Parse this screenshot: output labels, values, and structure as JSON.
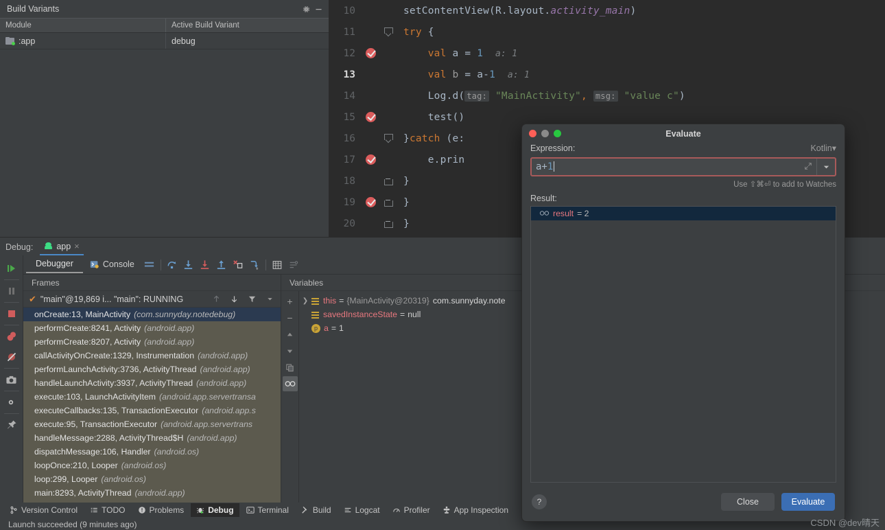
{
  "build_variants": {
    "title": "Build Variants",
    "gear_icon": "gear-icon",
    "minimize_icon": "minimize-icon",
    "columns": [
      "Module",
      "Active Build Variant"
    ],
    "rows": [
      {
        "module": ":app",
        "variant": "debug"
      }
    ]
  },
  "editor": {
    "lines": [
      {
        "num": "10",
        "tokens": [
          {
            "t": "setContentView(",
            "c": "k-plain"
          },
          {
            "t": "R",
            "c": "k-plain"
          },
          {
            "t": ".",
            "c": "k-plain"
          },
          {
            "t": "layout",
            "c": "k-plain"
          },
          {
            "t": ".",
            "c": "k-plain"
          },
          {
            "t": "activity_main",
            "c": "k-fld"
          },
          {
            "t": ")",
            "c": "k-plain"
          }
        ]
      },
      {
        "num": "11",
        "tokens": [
          {
            "t": "try",
            "c": "k-kw"
          },
          {
            "t": " {",
            "c": "k-plain"
          }
        ]
      },
      {
        "num": "12",
        "tokens": [
          {
            "t": "    val ",
            "c": "k-kw"
          },
          {
            "t": "a",
            "c": "k-plain"
          },
          {
            "t": " = ",
            "c": "k-plain"
          },
          {
            "t": "1",
            "c": "k-num"
          },
          {
            "t": "  ",
            "c": "k-plain"
          },
          {
            "t": "a: 1",
            "c": "k-hint"
          }
        ]
      },
      {
        "num": "13",
        "tokens": [
          {
            "t": "    val ",
            "c": "k-kw"
          },
          {
            "t": "b",
            "c": "k-dim"
          },
          {
            "t": " = ",
            "c": "k-plain"
          },
          {
            "t": "a-",
            "c": "k-plain"
          },
          {
            "t": "1",
            "c": "k-num"
          },
          {
            "t": "  ",
            "c": "k-plain"
          },
          {
            "t": "a: 1",
            "c": "k-hint"
          }
        ]
      },
      {
        "num": "14",
        "tokens": [
          {
            "t": "    Log.d(",
            "c": "k-plain"
          },
          {
            "t": "tag:",
            "c": "chip"
          },
          {
            "t": " ",
            "c": "k-plain"
          },
          {
            "t": "\"MainActivity\"",
            "c": "k-str"
          },
          {
            "t": ",",
            "c": "k-kw"
          },
          {
            "t": " ",
            "c": "k-plain"
          },
          {
            "t": "msg:",
            "c": "chip"
          },
          {
            "t": " ",
            "c": "k-plain"
          },
          {
            "t": "\"value c\"",
            "c": "k-str"
          },
          {
            "t": ")",
            "c": "k-plain"
          }
        ]
      },
      {
        "num": "15",
        "tokens": [
          {
            "t": "    test()",
            "c": "k-plain"
          }
        ]
      },
      {
        "num": "16",
        "tokens": [
          {
            "t": "}",
            "c": "k-plain"
          },
          {
            "t": "catch",
            "c": "k-kw"
          },
          {
            "t": " (e:",
            "c": "k-plain"
          }
        ]
      },
      {
        "num": "17",
        "tokens": [
          {
            "t": "    e.prin",
            "c": "k-plain"
          }
        ]
      },
      {
        "num": "18",
        "tokens": [
          {
            "t": "}",
            "c": "k-plain"
          }
        ]
      },
      {
        "num": "19",
        "tokens": [
          {
            "t": "}",
            "c": "k-plain"
          }
        ]
      },
      {
        "num": "20",
        "tokens": [
          {
            "t": "}",
            "c": "k-plain"
          }
        ]
      }
    ]
  },
  "debug": {
    "label": "Debug:",
    "tab_name": "app",
    "close_icon": "close-icon",
    "toolbar": {
      "debugger_tab": "Debugger",
      "console_tab": "Console",
      "icons": [
        "layout-icon",
        "step-over-icon",
        "step-into-icon",
        "force-step-into-icon",
        "step-out-icon",
        "run-to-cursor-icon",
        "drop-frame-icon",
        "evaluate-table-icon",
        "settings-list-icon"
      ]
    },
    "side_icons": [
      "resume-icon",
      "pause-icon",
      "stop-icon",
      "view-breakpoints-icon",
      "mute-breakpoints-icon",
      "camera-icon",
      "settings-gear-icon",
      "pin-icon"
    ],
    "frames_header": "Frames",
    "thread": {
      "status": "\"main\"@19,869 i... \"main\": RUNNING",
      "check_icon": "check-icon",
      "controls": [
        "arrow-up-icon",
        "arrow-down-icon",
        "filter-icon",
        "chevron-down-icon"
      ]
    },
    "frames": [
      {
        "method": "onCreate:13, MainActivity",
        "pkg": "(com.sunnyday.notedebug)",
        "selected": true
      },
      {
        "method": "performCreate:8241, Activity",
        "pkg": "(android.app)",
        "selected": false
      },
      {
        "method": "performCreate:8207, Activity",
        "pkg": "(android.app)",
        "selected": false
      },
      {
        "method": "callActivityOnCreate:1329, Instrumentation",
        "pkg": "(android.app)",
        "selected": false
      },
      {
        "method": "performLaunchActivity:3736, ActivityThread",
        "pkg": "(android.app)",
        "selected": false
      },
      {
        "method": "handleLaunchActivity:3937, ActivityThread",
        "pkg": "(android.app)",
        "selected": false
      },
      {
        "method": "execute:103, LaunchActivityItem",
        "pkg": "(android.app.servertransa",
        "selected": false
      },
      {
        "method": "executeCallbacks:135, TransactionExecutor",
        "pkg": "(android.app.s",
        "selected": false
      },
      {
        "method": "execute:95, TransactionExecutor",
        "pkg": "(android.app.servertrans",
        "selected": false
      },
      {
        "method": "handleMessage:2288, ActivityThread$H",
        "pkg": "(android.app)",
        "selected": false
      },
      {
        "method": "dispatchMessage:106, Handler",
        "pkg": "(android.os)",
        "selected": false
      },
      {
        "method": "loopOnce:210, Looper",
        "pkg": "(android.os)",
        "selected": false
      },
      {
        "method": "loop:299, Looper",
        "pkg": "(android.os)",
        "selected": false
      },
      {
        "method": "main:8293, ActivityThread",
        "pkg": "(android.app)",
        "selected": false
      }
    ],
    "variables_header": "Variables",
    "variables": [
      {
        "expandable": true,
        "icon": "object-icon",
        "name": "this",
        "value": "{MainActivity@20319}",
        "extra": "com.sunnyday.note",
        "ref": true
      },
      {
        "expandable": false,
        "icon": "object-icon",
        "name": "savedInstanceState",
        "value": "null",
        "extra": "",
        "ref": false
      },
      {
        "expandable": false,
        "icon": "primitive-icon",
        "name": "a",
        "value": "1",
        "extra": "",
        "ref": false
      }
    ],
    "vars_side_icons": [
      "add-icon",
      "remove-icon",
      "arrow-up-icon",
      "arrow-down-icon",
      "copy-icon",
      "watches-icon"
    ]
  },
  "evaluate_dialog": {
    "title": "Evaluate",
    "traffic_lights": [
      "close-traffic-light",
      "minimize-traffic-light",
      "maximize-traffic-light"
    ],
    "expression_label": "Expression:",
    "language": "Kotlin",
    "expression_value": "a+1",
    "expression_prefix": "a+",
    "expression_number": "1",
    "expand_icon": "expand-icon",
    "dropdown_icon": "chevron-down-icon",
    "hint": "Use ⇧⌘⏎ to add to Watches",
    "result_label": "Result:",
    "result_icon": "watches-icon",
    "result_name": "result",
    "result_value": "= 2",
    "help_label": "?",
    "close_label": "Close",
    "evaluate_label": "Evaluate"
  },
  "statusbar": {
    "tabs": [
      {
        "label": "Version Control",
        "icon": "branch-icon",
        "active": false
      },
      {
        "label": "TODO",
        "icon": "list-icon",
        "active": false
      },
      {
        "label": "Problems",
        "icon": "warning-icon",
        "active": false
      },
      {
        "label": "Debug",
        "icon": "bug-icon",
        "active": true
      },
      {
        "label": "Terminal",
        "icon": "terminal-icon",
        "active": false
      },
      {
        "label": "Build",
        "icon": "hammer-icon",
        "active": false
      },
      {
        "label": "Logcat",
        "icon": "logcat-icon",
        "active": false
      },
      {
        "label": "Profiler",
        "icon": "profiler-icon",
        "active": false
      },
      {
        "label": "App Inspection",
        "icon": "inspection-icon",
        "active": false
      }
    ],
    "message": "Launch succeeded (9 minutes ago)"
  },
  "watermark": "CSDN @dev晴天",
  "colors": {
    "background": "#3c3f41",
    "editor_bg": "#2b2b2b",
    "selection_blue": "#2f659d",
    "breakpoint_red": "#db5c5c",
    "breakpoint_line_bg": "#3b2527",
    "accent_blue": "#3b6eb4",
    "frames_bg": "#5c5a4e",
    "error_border": "#a85a5a"
  }
}
